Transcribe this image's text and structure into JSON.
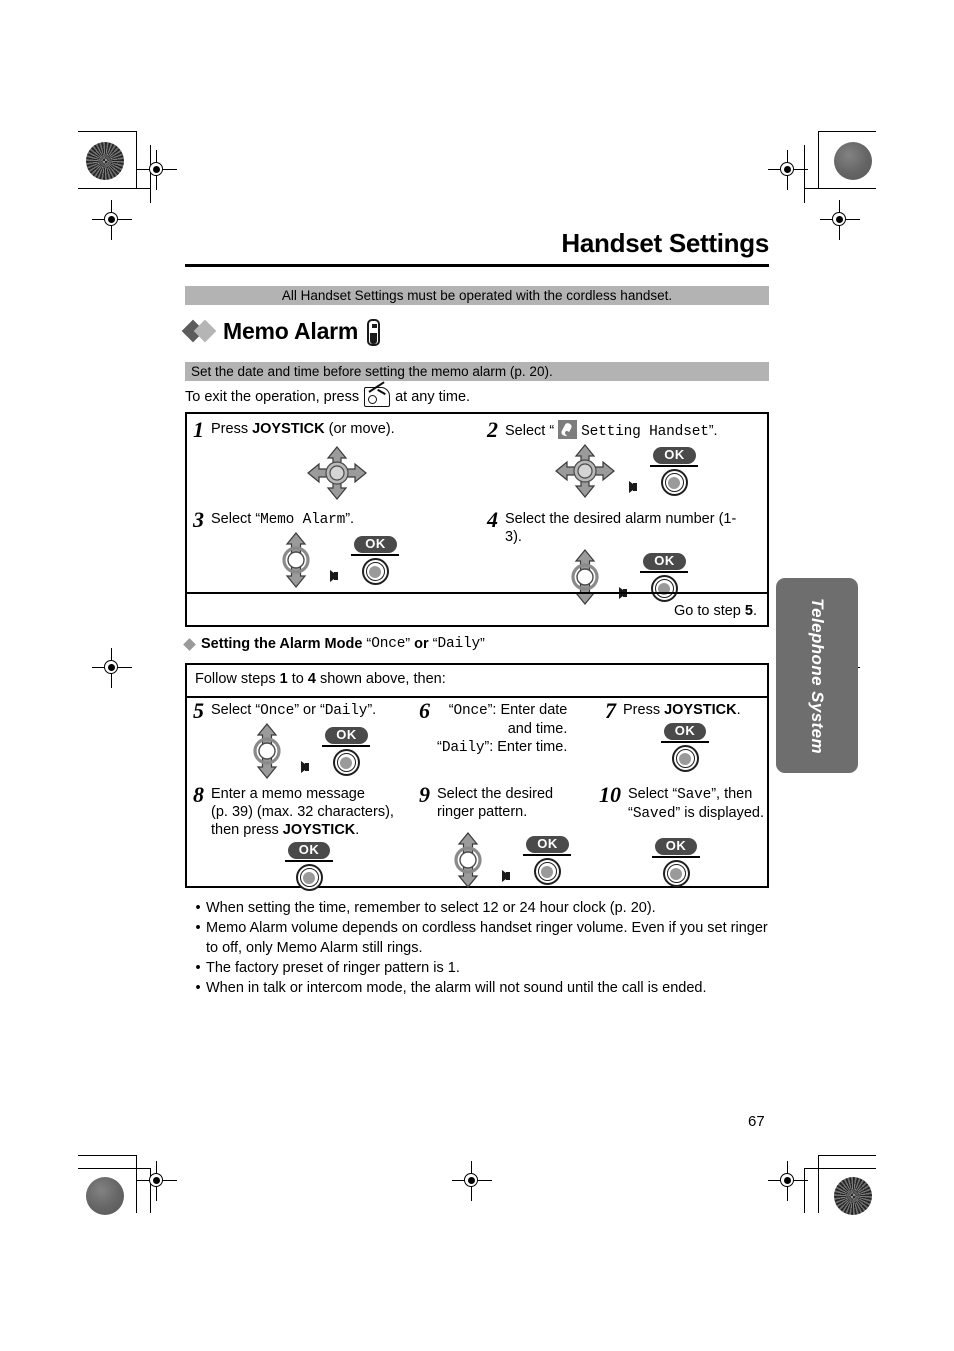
{
  "header": {
    "title": "Handset Settings",
    "banner_note": "All Handset Settings must be operated with the cordless handset."
  },
  "section": {
    "heading": "Memo Alarm",
    "subbanner": "Set the date and time before setting the memo alarm (p. 20).",
    "exit_before": "To exit the operation, press",
    "exit_after": "at any time."
  },
  "steps_main": [
    {
      "num": "1",
      "text_pre": "Press ",
      "text_bold": "JOYSTICK",
      "text_post": " (or move).",
      "icons": "joystick4"
    },
    {
      "num": "2",
      "text_pre": "Select “",
      "text_mono": "Setting Handset",
      "text_post": "”.",
      "icons": "joystick4-arrow-ok",
      "ok_label": "OK"
    },
    {
      "num": "3",
      "text_pre": "Select “",
      "text_mono": "Memo Alarm",
      "text_post": "”.",
      "icons": "joystick2-arrow-ok",
      "ok_label": "OK"
    },
    {
      "num": "4",
      "text_pre": "Select the desired alarm number (1-3).",
      "icons": "joystick2-arrow-ok",
      "ok_label": "OK"
    }
  ],
  "goto_note_pre": "Go to step ",
  "goto_note_num": "5",
  "goto_note_post": ".",
  "subsection": {
    "heading_bold": "Setting the Alarm Mode",
    "heading_q1": "Once",
    "heading_or": "or",
    "heading_q2": "Daily",
    "follow_pre": "Follow steps ",
    "follow_n1": "1",
    "follow_mid": " to ",
    "follow_n2": "4",
    "follow_post": " shown above, then:"
  },
  "steps_mode": [
    {
      "num": "5",
      "text_pre": "Select “",
      "text_mono": "Once",
      "text_mid": "” or “",
      "text_mono2": "Daily",
      "text_post": "”.",
      "ok_label": "OK"
    },
    {
      "num": "6",
      "line1_mono": "Once",
      "line1_post": "”: Enter date",
      "line2": "and time.",
      "line3_mono": "Daily",
      "line3_post": "”: Enter time."
    },
    {
      "num": "7",
      "text_pre": "Press ",
      "text_bold": "JOYSTICK",
      "text_post": ".",
      "ok_label": "OK"
    },
    {
      "num": "8",
      "line1": "Enter a memo message",
      "line2": "(p. 39) (max. 32 characters),",
      "line3_pre": "then press ",
      "line3_bold": "JOYSTICK",
      "line3_post": ".",
      "ok_label": "OK"
    },
    {
      "num": "9",
      "line1": "Select the desired",
      "line2": "ringer pattern.",
      "ok_label": "OK"
    },
    {
      "num": "10",
      "line1_pre": "Select “",
      "line1_mono": "Save",
      "line1_post": "”, then",
      "line2_pre": "“",
      "line2_mono": "Saved",
      "line2_post": "” is displayed.",
      "ok_label": "OK"
    }
  ],
  "notes": [
    "When setting the time, remember to select 12 or 24 hour clock (p. 20).",
    "Memo Alarm volume depends on cordless handset ringer volume. Even if you set ringer to off, only Memo Alarm still rings.",
    "The factory preset of ringer pattern is 1.",
    "When in talk or intercom mode, the alarm will not sound until the call is ended."
  ],
  "side_tab": {
    "label": "Telephone System"
  },
  "page_number": "67",
  "colors": {
    "banner_gray": "#b3b3b3",
    "tab_gray": "#6e6e6e",
    "ok_pill": "#4a4a4a"
  }
}
